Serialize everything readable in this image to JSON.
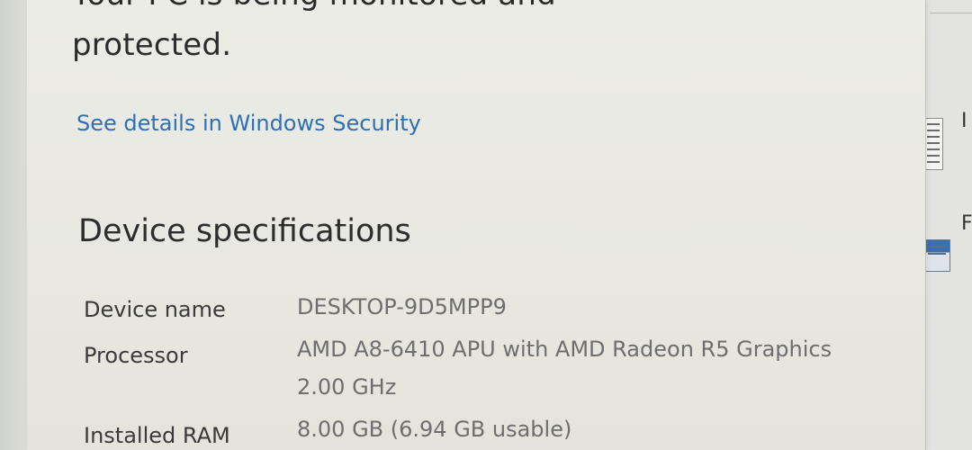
{
  "security": {
    "status_line_1": "Your PC is being monitored and",
    "status_line_2": "protected.",
    "details_link": "See details in Windows Security"
  },
  "device_specifications": {
    "title": "Device specifications",
    "specs": [
      {
        "label": "Device name",
        "value": "DESKTOP-9D5MPP9",
        "value_line_2": ""
      },
      {
        "label": "Processor",
        "value": "AMD A8-6410 APU with AMD Radeon R5 Graphics",
        "value_line_2": "2.00 GHz"
      },
      {
        "label": "Installed RAM",
        "value": "8.00 GB (6.94 GB usable)",
        "value_line_2": ""
      }
    ]
  },
  "background_window": {
    "letter_1": "I",
    "letter_2": "F"
  },
  "colors": {
    "link": "#2f6fb5",
    "panel_bg": "#ecece6",
    "label_text": "#3a3a3a",
    "value_text": "#6e6e6e"
  },
  "icons": {
    "background_file": "document-icon",
    "background_app": "app-window-icon"
  }
}
